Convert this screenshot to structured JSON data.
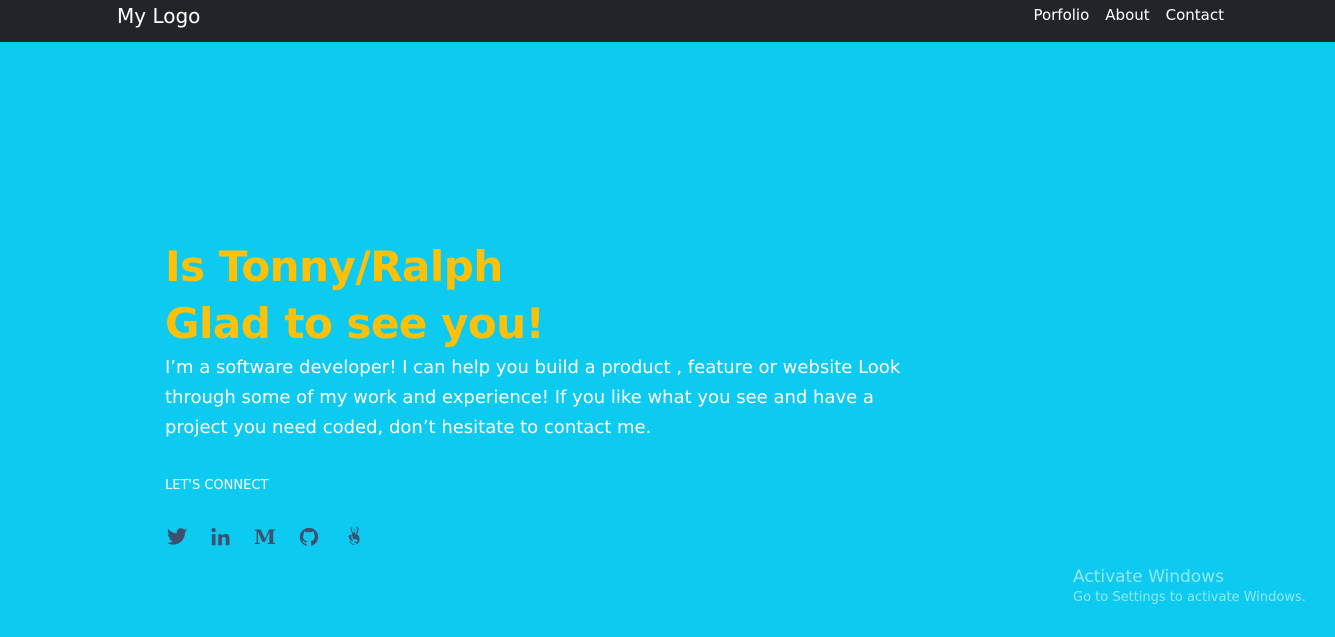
{
  "navbar": {
    "logo": "My Logo",
    "links": [
      "Porfolio",
      "About",
      "Contact"
    ]
  },
  "hero": {
    "headline_line1": "Is Tonny/Ralph",
    "headline_line2": "Glad to see you!",
    "intro": "I’m a software developer! I can help you build a product , feature or website Look through some of my work and experience! If you like what you see and have a project you need coded, don’t hesitate to contact me.",
    "connect_label": "LET'S CONNECT",
    "socials": [
      {
        "name": "twitter-icon"
      },
      {
        "name": "linkedin-icon"
      },
      {
        "name": "medium-icon"
      },
      {
        "name": "github-icon"
      },
      {
        "name": "angellist-icon"
      }
    ]
  },
  "watermark": {
    "title": "Activate Windows",
    "subtitle": "Go to Settings to activate Windows."
  },
  "colors": {
    "background": "#0ccaf0",
    "navbar": "#212529",
    "headline": "#ffc107",
    "icons": "#3f4f6e"
  }
}
